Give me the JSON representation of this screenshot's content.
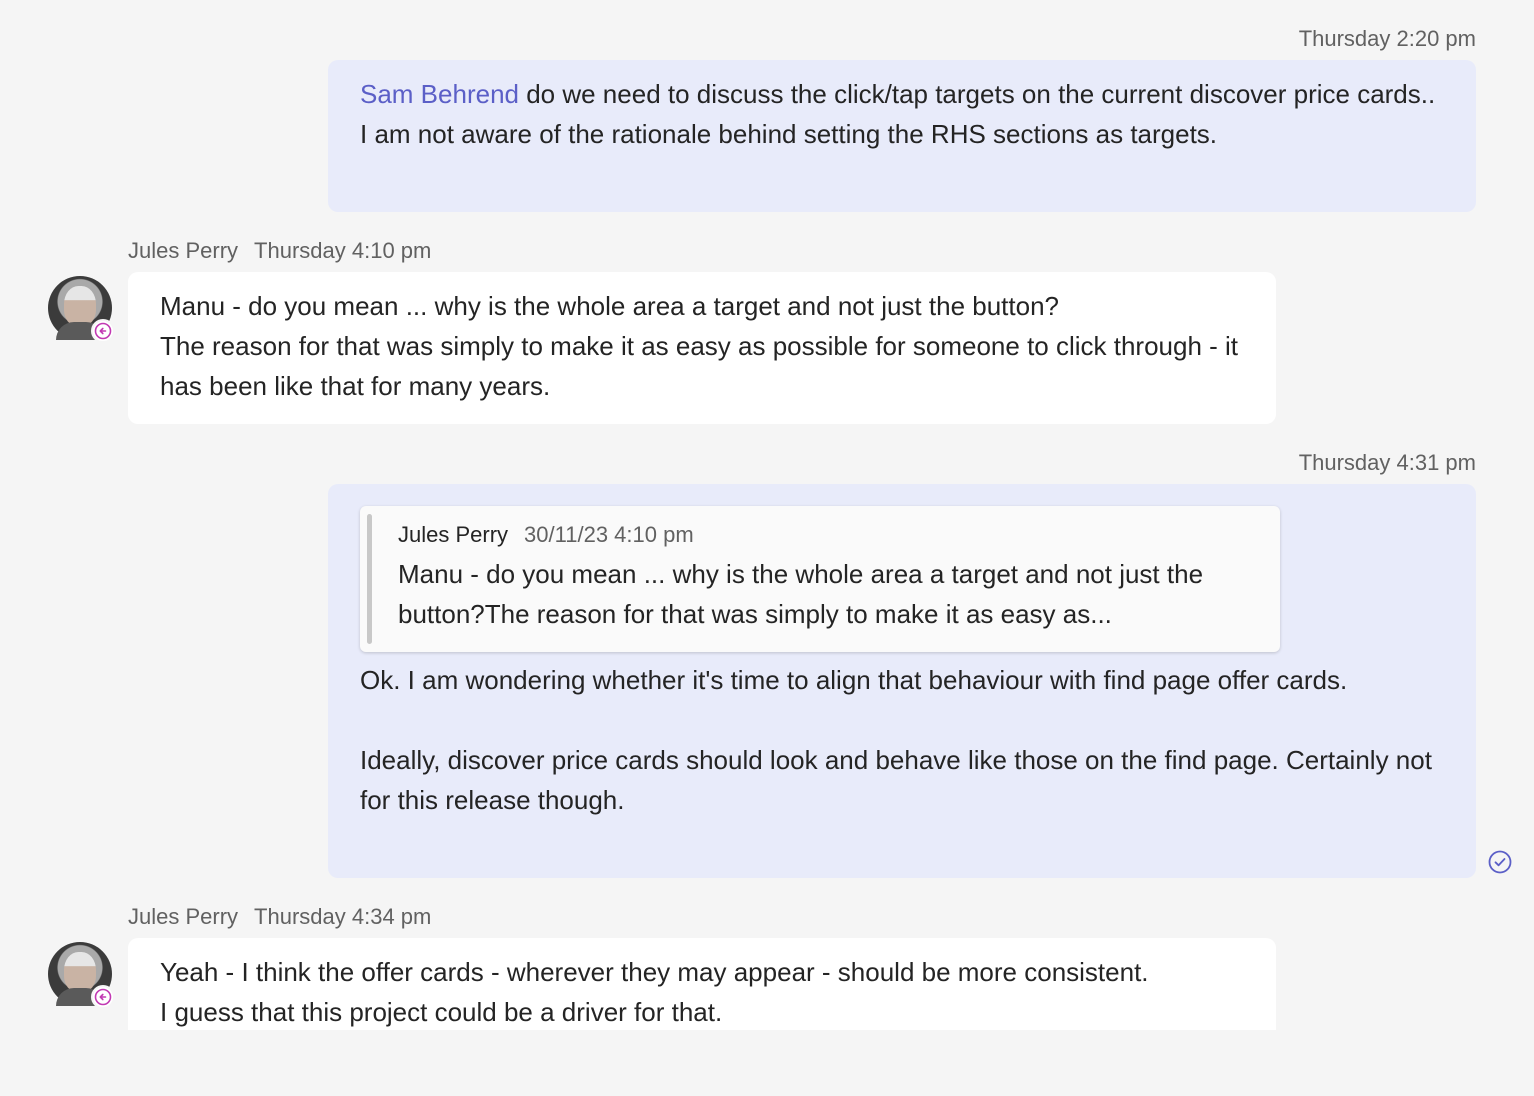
{
  "messages": [
    {
      "time": "Thursday 2:20 pm",
      "mention": "Sam Behrend",
      "text": " do we need to discuss the click/tap targets on the current discover price cards.. I am not aware of the rationale behind setting the  RHS sections as targets."
    },
    {
      "sender": "Jules Perry",
      "time": "Thursday 4:10 pm",
      "lines": [
        "Manu - do you mean ... why is the whole area a target and not just the button?",
        "The reason for that was simply to make it as easy as possible for someone to click through - it has been like that for many years."
      ]
    },
    {
      "time": "Thursday 4:31 pm",
      "quote": {
        "sender": "Jules Perry",
        "time": "30/11/23 4:10 pm",
        "text": "Manu - do you mean ... why is the whole area a target and not just the button?The reason for that was simply to make it as easy as..."
      },
      "para1": "Ok. I am wondering whether it's time to align that behaviour with find page offer cards.",
      "para2": "Ideally, discover price cards should look and behave like those on the find page. Certainly not for this release though."
    },
    {
      "sender": "Jules Perry",
      "time": "Thursday 4:34 pm",
      "text": "Yeah - I think the offer cards - wherever they may appear - should be more consistent.  I guess that this project could be a driver for that."
    }
  ],
  "icons": {
    "avatar": "avatar-icon",
    "presence": "presence-away-icon",
    "read": "read-receipt-icon"
  },
  "colors": {
    "background": "#f5f5f5",
    "outgoing_bubble": "#e8ebfa",
    "incoming_bubble": "#ffffff",
    "mention": "#5b5fc7",
    "presence": "#c239b3",
    "read_receipt": "#5b5fc7"
  }
}
